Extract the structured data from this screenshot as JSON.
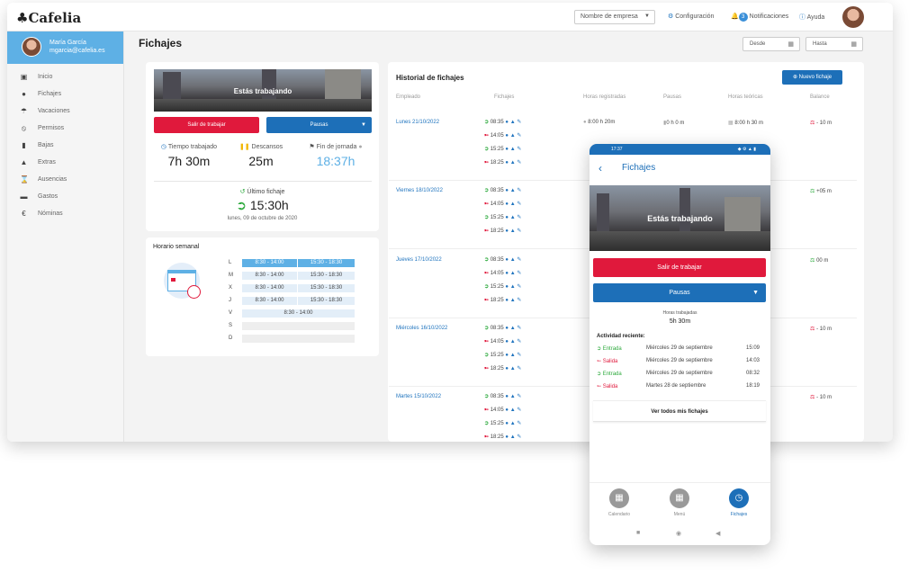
{
  "app": {
    "name": "Cafelia"
  },
  "topbar": {
    "company_select": "Nombre de empresa",
    "config": "Configuración",
    "notifications": "Notificaciones",
    "notif_count": "3",
    "help": "Ayuda"
  },
  "user": {
    "name": "María García",
    "email": "mgarcia@cafelia.es"
  },
  "sidebar": {
    "items": [
      {
        "label": "Inicio",
        "icon": "home-icon"
      },
      {
        "label": "Fichajes",
        "icon": "clock-icon"
      },
      {
        "label": "Vacaciones",
        "icon": "umbrella-icon"
      },
      {
        "label": "Permisos",
        "icon": "permission-icon"
      },
      {
        "label": "Bajas",
        "icon": "thermometer-icon"
      },
      {
        "label": "Extras",
        "icon": "extras-icon"
      },
      {
        "label": "Ausencias",
        "icon": "hourglass-icon"
      },
      {
        "label": "Gastos",
        "icon": "card-icon"
      },
      {
        "label": "Nóminas",
        "icon": "euro-icon"
      }
    ]
  },
  "page": {
    "title": "Fichajes",
    "desde": "Desde",
    "hasta": "Hasta"
  },
  "status_card": {
    "photo_text": "Estás trabajando",
    "exit_button": "Salir de trabajar",
    "pause_button": "Pausas",
    "stats": [
      {
        "label": "Tiempo trabajado",
        "value": "7h 30m"
      },
      {
        "label": "Descansos",
        "value": "25m"
      },
      {
        "label": "Fin de jornada",
        "value": "18:37h"
      }
    ],
    "last_label": "Último fichaje",
    "last_time": "15:30h",
    "last_date": "lunes, 09 de octubre de 2020"
  },
  "schedule": {
    "title": "Horario semanal",
    "days": [
      {
        "day": "L",
        "morning": "8:30 - 14:00",
        "afternoon": "15:30 - 18:30"
      },
      {
        "day": "M",
        "morning": "8:30 - 14:00",
        "afternoon": "15:30 - 18:30"
      },
      {
        "day": "X",
        "morning": "8:30 - 14:00",
        "afternoon": "15:30 - 18:30"
      },
      {
        "day": "J",
        "morning": "8:30 - 14:00",
        "afternoon": "15:30 - 18:30"
      },
      {
        "day": "V",
        "single": "8:30 - 14:00"
      },
      {
        "day": "S"
      },
      {
        "day": "D"
      }
    ]
  },
  "history": {
    "title": "Historial de fichajes",
    "new_button": "Nuevo fichaje",
    "columns": [
      "Empleado",
      "Fichajes",
      "Horas registradas",
      "Pausas",
      "Horas teóricas",
      "Balance"
    ],
    "rows": [
      {
        "date": "Lunes 21/10/2022",
        "times": [
          "08:35",
          "14:05",
          "15:25",
          "18:25"
        ],
        "registered": "8:00 h 20m",
        "pauses": "0 h 0 m",
        "theoretical": "8:00 h 30 m",
        "balance": "- 10 m"
      },
      {
        "date": "Viernes 18/10/2022",
        "times": [
          "08:35",
          "14:05",
          "15:25",
          "18:25"
        ],
        "balance": "+05 m"
      },
      {
        "date": "Jueves 17/10/2022",
        "times": [
          "08:35",
          "14:05",
          "15:25",
          "18:25"
        ],
        "balance": "00 m"
      },
      {
        "date": "Miércoles 16/10/2022",
        "times": [
          "08:35",
          "14:05",
          "15:25",
          "18:25"
        ],
        "balance": "- 10 m"
      },
      {
        "date": "Martes 15/10/2022",
        "times": [
          "08:35",
          "14:05",
          "15:25",
          "18:25"
        ],
        "balance": "- 10 m"
      }
    ]
  },
  "phone": {
    "status_time": "17:37",
    "title": "Fichajes",
    "photo_text": "Estás trabajando",
    "exit_button": "Salir de trabajar",
    "pause_button": "Pausas",
    "hours_label": "Horas trabajadas",
    "hours_value": "5h 30m",
    "activity_title": "Actividad reciente:",
    "activity": [
      {
        "type": "Entrada",
        "date": "Miércoles 29 de septiembre",
        "time": "15:09"
      },
      {
        "type": "Salida",
        "date": "Miércoles 29 de septiembre",
        "time": "14:03"
      },
      {
        "type": "Entrada",
        "date": "Miércoles 29 de septiembre",
        "time": "08:32"
      },
      {
        "type": "Salida",
        "date": "Martes 28 de septiembre",
        "time": "18:19"
      }
    ],
    "see_all": "Ver todos mis fichajes",
    "nav": [
      "Calendario",
      "Menú",
      "Fichajes"
    ]
  },
  "colors": {
    "accent": "#1d6fb8",
    "red": "#e0193c",
    "green": "#2eaa3e",
    "sidebar_user": "#5eb0e5"
  }
}
